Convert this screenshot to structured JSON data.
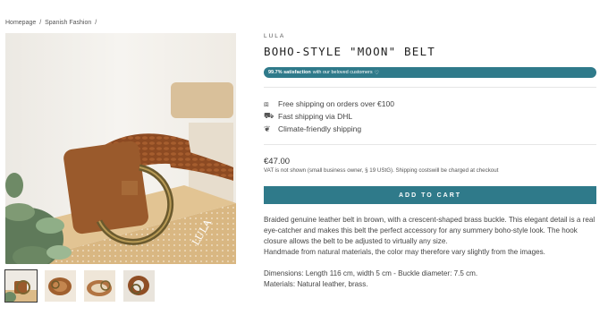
{
  "breadcrumb": {
    "items": [
      "Homepage",
      "/",
      "Spanish Fashion",
      "/"
    ]
  },
  "product": {
    "brand": "LULA",
    "title": "BOHO-STYLE \"MOON\" BELT",
    "satisfaction_bold": "99.7% satisfaction",
    "satisfaction_rest": "with our beloved customers",
    "features": [
      {
        "icon": "package-icon",
        "label": "Free shipping on orders over €100"
      },
      {
        "icon": "truck-icon",
        "label": "Fast shipping via DHL"
      },
      {
        "icon": "leaf-icon",
        "label": "Climate-friendly shipping"
      }
    ],
    "price": "€47.00",
    "vat_note": "VAT is not shown (small business owner, § 19 UStG). Shipping costswill be charged at checkout",
    "add_to_cart": "ADD TO CART",
    "description": "Braided genuine leather belt in brown, with a crescent-shaped brass buckle. This elegant detail is a real eye-catcher and makes this belt the perfect accessory for any summery boho-style look. The hook closure allows the belt to be adjusted to virtually any size.",
    "description_2": "Handmade from natural materials, the color may therefore vary slightly from the images.",
    "dimensions": "Dimensions: Length 116 cm, width 5 cm - Buckle diameter: 7.5 cm.",
    "materials": "Materials: Natural leather, brass."
  },
  "gallery": {
    "box_label": "LULA",
    "thumbnail_count": 4,
    "active_thumbnail": 0
  },
  "colors": {
    "accent": "#2f7a8a"
  }
}
